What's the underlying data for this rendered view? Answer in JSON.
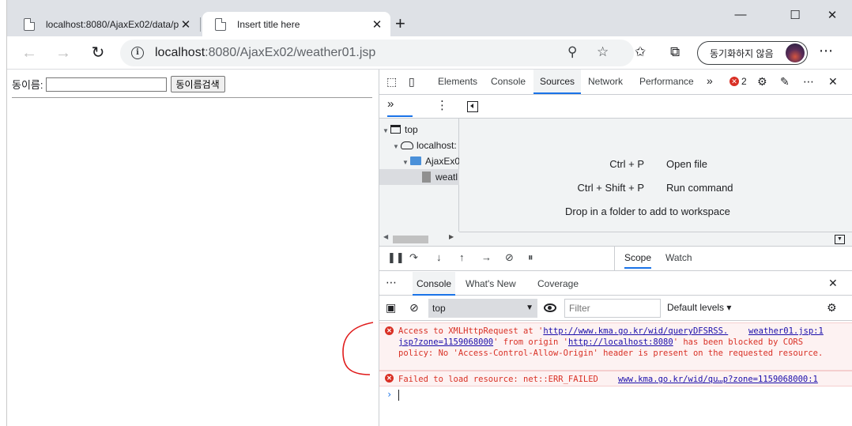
{
  "browser": {
    "tabs": [
      {
        "title": "localhost:8080/AjaxEx02/data/p",
        "active": false
      },
      {
        "title": "Insert title here",
        "active": true
      }
    ],
    "close_glyph": "✕",
    "newtab_glyph": "+",
    "window_controls": [
      "—",
      "☐",
      "✕"
    ],
    "url_host": "localhost",
    "url_rest": ":8080/AjaxEx02/weather01.jsp",
    "sync_label": "동기화하지 않음",
    "more_glyph": "⋯"
  },
  "page": {
    "label": "동이름:",
    "input_value": "",
    "button_label": "동이름검색"
  },
  "devtools": {
    "tabs": [
      "Elements",
      "Console",
      "Sources",
      "Network",
      "Performance"
    ],
    "active_tab": "Sources",
    "overflow_glyph": "»",
    "error_count": "2",
    "tree": [
      {
        "label": "top",
        "icon": "frame"
      },
      {
        "label": "localhost:",
        "icon": "cloud"
      },
      {
        "label": "AjaxEx0",
        "icon": "folder"
      },
      {
        "label": "weatl",
        "icon": "file"
      }
    ],
    "shortcuts": [
      {
        "key": "Ctrl + P",
        "desc": "Open file"
      },
      {
        "key": "Ctrl + Shift + P",
        "desc": "Run command"
      }
    ],
    "workspace_hint": "Drop in a folder to add to workspace",
    "scope_tabs": [
      "Scope",
      "Watch"
    ],
    "drawer_tabs": [
      "Console",
      "What's New",
      "Coverage"
    ],
    "context": "top",
    "filter_placeholder": "Filter",
    "levels_label": "Default levels ▾",
    "messages": {
      "m1_prefix": "Access to XMLHttpRequest at '",
      "m1_url1": "http://www.kma.go.kr/wid/queryDFSRSS.",
      "m1_url1b": "jsp?zone=1159068000",
      "m1_mid": "' from origin '",
      "m1_url2": "http://localhost:8080",
      "m1_suffix": "' has been blocked by CORS policy: No 'Access-Control-Allow-Origin' header is present on the requested resource.",
      "m1_source": "weather01.jsp:1",
      "m2_text": "Failed to load resource: net::ERR_FAILED",
      "m2_source": "www.kma.go.kr/wid/qu…p?zone=1159068000:1"
    },
    "prompt_glyph": "›"
  },
  "colors": {
    "accent": "#1a73e8",
    "error": "#d93025",
    "annotation": "#e01b1b"
  }
}
